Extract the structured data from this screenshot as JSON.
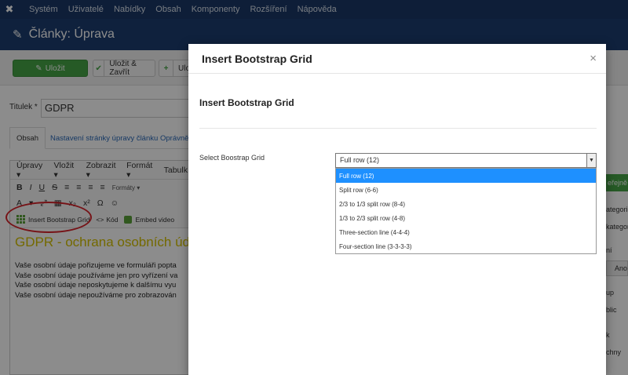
{
  "topnav": {
    "logo": "✖",
    "items": [
      "Systém",
      "Uživatelé",
      "Nabídky",
      "Obsah",
      "Komponenty",
      "Rozšíření",
      "Nápověda"
    ]
  },
  "page": {
    "title": "Články: Úprava"
  },
  "toolbar": {
    "save_label": "Uložit",
    "save_close_label": "Uložit & Zavřít",
    "save_new_label": "Ulo"
  },
  "title_field": {
    "label": "Titulek *",
    "value": "GDPR"
  },
  "tabs": [
    "Obsah",
    "Nastavení stránky úpravy článku",
    "Oprávně"
  ],
  "editor": {
    "menu": [
      "Úpravy ▾",
      "Vložit ▾",
      "Zobrazit ▾",
      "Formát ▾",
      "Tabulk"
    ],
    "formats_label": "Formáty ▾",
    "insert_grid_label": "Insert Bootstrap Grid",
    "code_label": "Kód",
    "embed_label": "Embed video",
    "heading": "GDPR - ochrana osobních úd",
    "paragraphs": [
      "Vaše osobní údaje pořizujeme ve formuláři popta",
      "Vaše osobní údaje používáme jen pro vyřízení va",
      "Vaše osobní údaje neposkytujeme k dalšímu vyu",
      "Vaše osobní údaje nepoužíváme pro zobrazován"
    ]
  },
  "right_panel": {
    "publish_label": "eřejně",
    "lines": [
      "ategorie (je",
      "kategor",
      "ní",
      "Ano",
      "up",
      "blic",
      "k",
      "chny"
    ]
  },
  "modal": {
    "header_title": "Insert Bootstrap Grid",
    "close": "×",
    "body_title": "Insert Bootstrap Grid",
    "select_label": "Select Boostrap Grid",
    "select_value": "Full row (12)",
    "options": [
      "Full row (12)",
      "Split row (6-6)",
      "2/3 to 1/3 split row (8-4)",
      "1/3 to 2/3 split row (4-8)",
      "Three-section line (4-4-4)",
      "Four-section line (3-3-3-3)"
    ],
    "selected_index": 0
  },
  "colors": {
    "nav_bg": "#1a3867",
    "title_bg": "#1c3d6f",
    "success": "#46a546",
    "highlight": "#1e90ff",
    "annotation": "#d8232a"
  }
}
